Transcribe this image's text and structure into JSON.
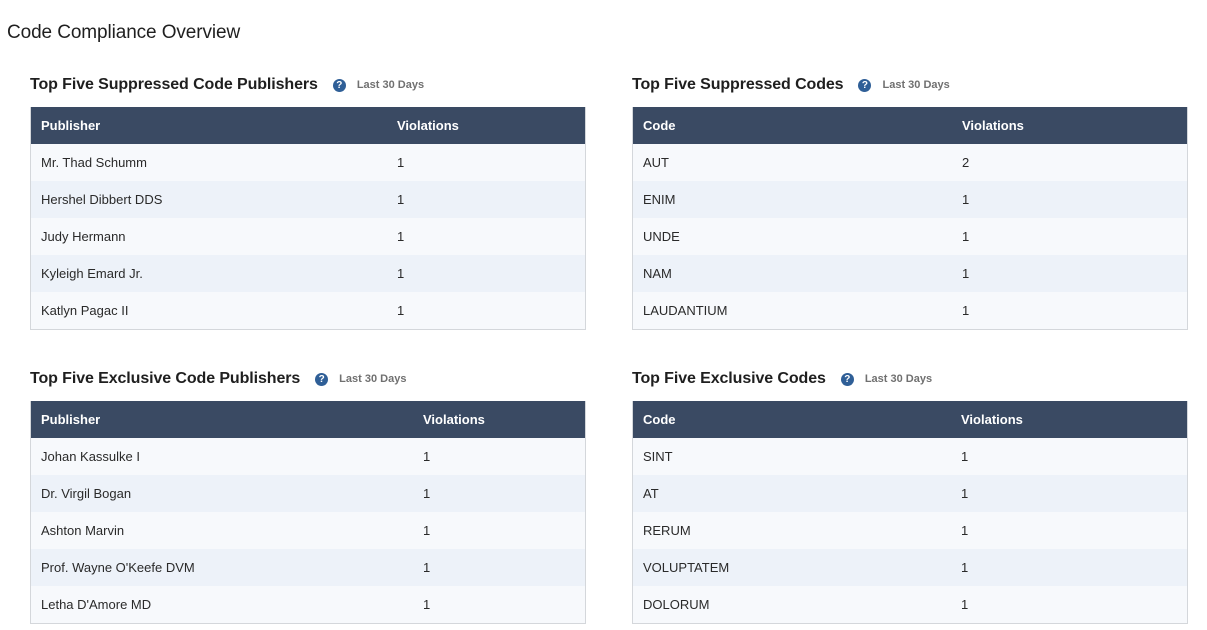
{
  "page": {
    "title": "Code Compliance Overview"
  },
  "panels": {
    "suppressed_publishers": {
      "title": "Top Five Suppressed Code Publishers",
      "period": "Last 30 Days",
      "columns": [
        "Publisher",
        "Violations"
      ],
      "rows": [
        [
          "Mr. Thad Schumm",
          "1"
        ],
        [
          "Hershel Dibbert DDS",
          "1"
        ],
        [
          "Judy Hermann",
          "1"
        ],
        [
          "Kyleigh Emard Jr.",
          "1"
        ],
        [
          "Katlyn Pagac II",
          "1"
        ]
      ]
    },
    "suppressed_codes": {
      "title": "Top Five Suppressed Codes",
      "period": "Last 30 Days",
      "columns": [
        "Code",
        "Violations"
      ],
      "rows": [
        [
          "AUT",
          "2"
        ],
        [
          "ENIM",
          "1"
        ],
        [
          "UNDE",
          "1"
        ],
        [
          "NAM",
          "1"
        ],
        [
          "LAUDANTIUM",
          "1"
        ]
      ]
    },
    "exclusive_publishers": {
      "title": "Top Five Exclusive Code Publishers",
      "period": "Last 30 Days",
      "columns": [
        "Publisher",
        "Violations"
      ],
      "rows": [
        [
          "Johan Kassulke I",
          "1"
        ],
        [
          "Dr. Virgil Bogan",
          "1"
        ],
        [
          "Ashton Marvin",
          "1"
        ],
        [
          "Prof. Wayne O'Keefe DVM",
          "1"
        ],
        [
          "Letha D'Amore MD",
          "1"
        ]
      ]
    },
    "exclusive_codes": {
      "title": "Top Five Exclusive Codes",
      "period": "Last 30 Days",
      "columns": [
        "Code",
        "Violations"
      ],
      "rows": [
        [
          "SINT",
          "1"
        ],
        [
          "AT",
          "1"
        ],
        [
          "RERUM",
          "1"
        ],
        [
          "VOLUPTATEM",
          "1"
        ],
        [
          "DOLORUM",
          "1"
        ]
      ]
    }
  },
  "icons": {
    "help": "question-circle-icon",
    "help_glyph": "?"
  },
  "colors": {
    "header_bg": "#3a4a63",
    "row_odd": "#f7f9fc",
    "row_even": "#edf2f9",
    "help_icon": "#2f5f97"
  }
}
